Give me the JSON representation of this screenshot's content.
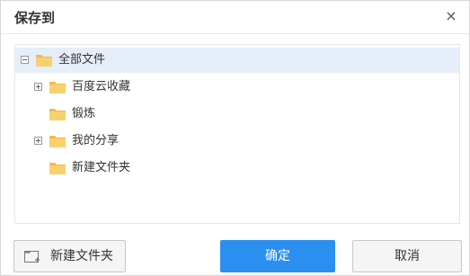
{
  "dialog": {
    "title": "保存到",
    "close_symbol": "×"
  },
  "tree": [
    {
      "label": "全部文件",
      "level": 0,
      "toggle": "collapse",
      "selected": true
    },
    {
      "label": "百度云收藏",
      "level": 1,
      "toggle": "expand",
      "selected": false
    },
    {
      "label": "锻炼",
      "level": 1,
      "toggle": "none",
      "selected": false
    },
    {
      "label": "我的分享",
      "level": 1,
      "toggle": "expand",
      "selected": false
    },
    {
      "label": "新建文件夹",
      "level": 1,
      "toggle": "none",
      "selected": false
    }
  ],
  "buttons": {
    "new_folder": "新建文件夹",
    "confirm": "确定",
    "cancel": "取消"
  },
  "colors": {
    "primary": "#2b8ff0",
    "selected_row": "#e5eef9",
    "folder": "#f6c55b"
  },
  "icons": {
    "folder": "folder-icon",
    "close": "close-icon",
    "expand": "plus-box-icon",
    "collapse": "minus-box-icon",
    "new_folder": "new-folder-icon"
  }
}
